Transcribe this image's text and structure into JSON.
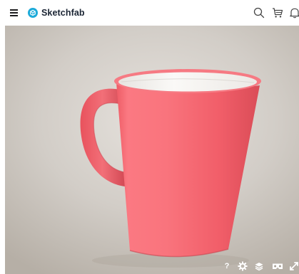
{
  "header": {
    "brand": "Sketchfab",
    "icons": [
      "menu-icon",
      "search-icon",
      "cart-icon",
      "notification-icon"
    ]
  },
  "viewer": {
    "controls": {
      "help_label": "?",
      "icons": [
        "help-icon",
        "settings-icon",
        "layers-icon",
        "vr-icon",
        "fullscreen-icon"
      ]
    }
  },
  "colors": {
    "brand": "#1caad9",
    "mug": "#f5646e",
    "mug_inside": "#f4f3f1",
    "background_light": "#e6e2dd",
    "background_dark": "#b6afa6"
  }
}
